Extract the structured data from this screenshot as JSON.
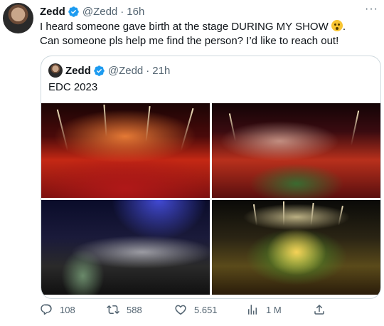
{
  "tweet": {
    "author_name": "Zedd",
    "author_handle": "@Zedd",
    "time": "16h",
    "text_line1": "I heard someone gave birth at the stage DURING MY SHOW",
    "text_line1_end": ".",
    "text_line2": "Can someone pls help me find the person? I’d like to reach out!",
    "more_label": "···"
  },
  "quote": {
    "author_name": "Zedd",
    "author_handle": "@Zedd",
    "time": "21h",
    "text": "EDC 2023",
    "images": [
      {
        "icon": "concert-red-fireworks"
      },
      {
        "icon": "concert-crowd-stage"
      },
      {
        "icon": "concert-dj-blue-lights"
      },
      {
        "icon": "concert-golden-stage"
      }
    ]
  },
  "actions": {
    "replies": "108",
    "retweets": "588",
    "likes": "5.651",
    "views": "1 M"
  },
  "colors": {
    "text": "#0f1419",
    "secondary": "#536471",
    "verified": "#1d9bf0",
    "border": "#cfd9de"
  }
}
